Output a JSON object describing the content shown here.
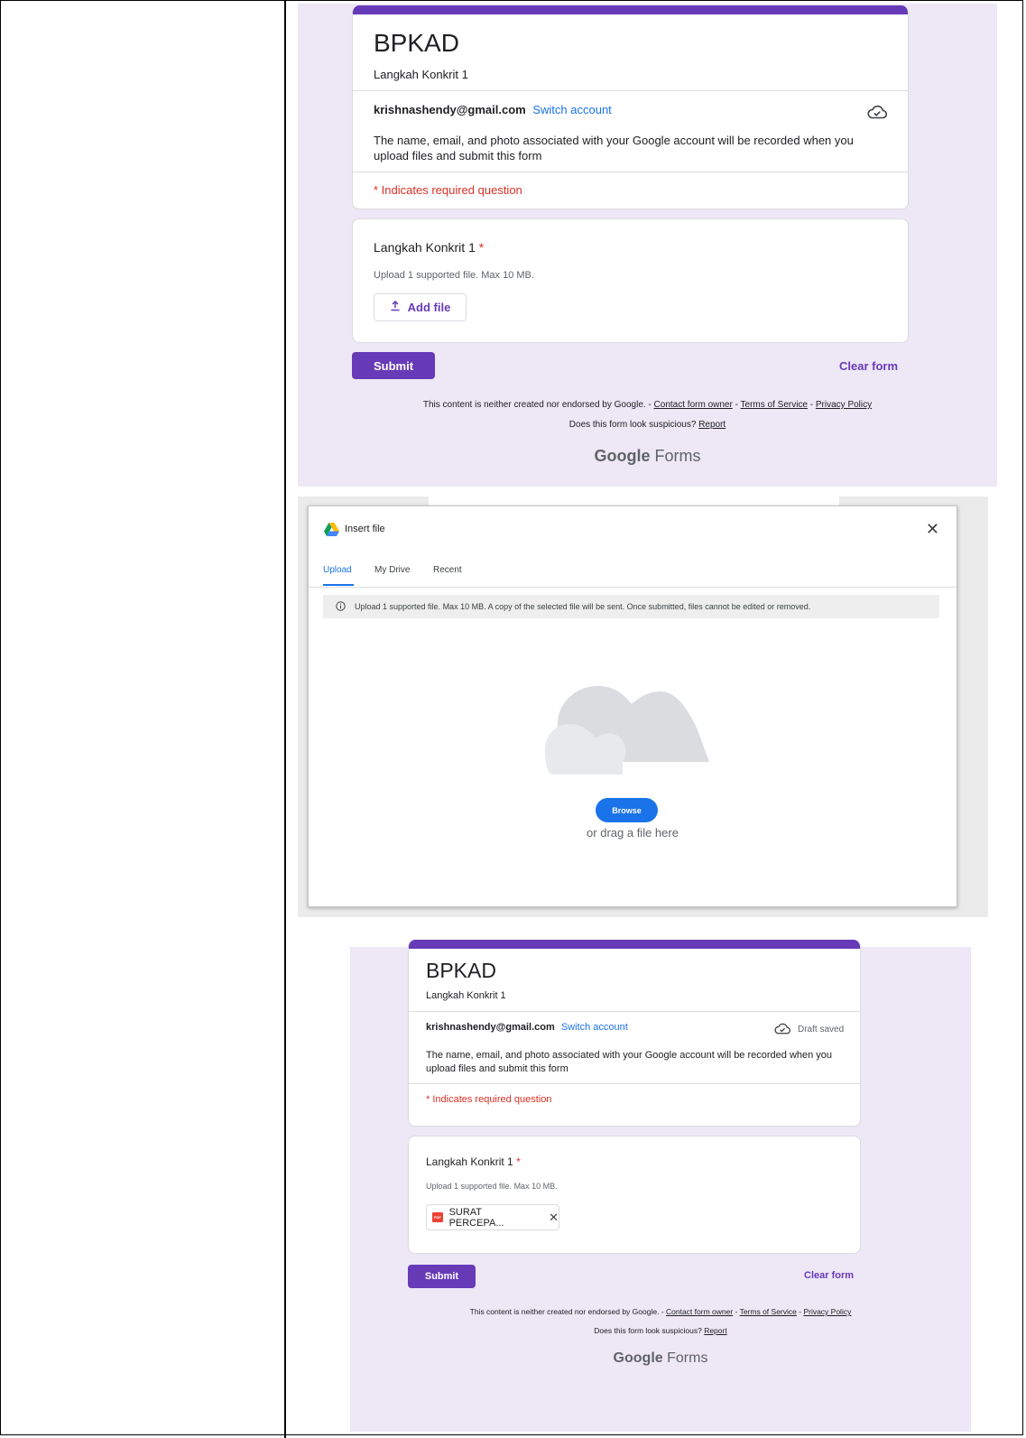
{
  "form": {
    "title": "BPKAD",
    "subtitle": "Langkah Konkrit 1",
    "email": "krishnashendy@gmail.com",
    "switch_account": "Switch account",
    "notice_line1": "The name, email, and photo associated with your Google account will be recorded when you",
    "notice_line2": "upload files and submit this form",
    "required_note": "* Indicates required question",
    "question_title": "Langkah Konkrit 1",
    "required_star": "*",
    "question_help": "Upload 1 supported file. Max 10 MB.",
    "add_file_label": "Add file",
    "submit_label": "Submit",
    "clear_label": "Clear form",
    "draft_saved": "Draft saved",
    "attached_file": "SURAT PERCEPA...",
    "accent_color": "#673ab7",
    "background_color": "#ede7f6"
  },
  "footer": {
    "disclaimer": "This content is neither created nor endorsed by Google.",
    "sep": " - ",
    "contact": "Contact form owner",
    "terms": "Terms of Service",
    "privacy": "Privacy Policy",
    "suspicious": "Does this form look suspicious?",
    "report": "Report",
    "brand_bold": "Google",
    "brand_rest": "Forms"
  },
  "dialog": {
    "title": "Insert file",
    "tabs": [
      "Upload",
      "My Drive",
      "Recent"
    ],
    "info": "Upload 1 supported file. Max 10 MB. A copy of the selected file will be sent. Once submitted, files cannot be edited or removed.",
    "browse_label": "Browse",
    "drag_text": "or drag a file here",
    "primary_color": "#1a73e8"
  },
  "icons": [
    "cloud-saved-icon",
    "upload-icon",
    "google-drive-icon",
    "close-icon",
    "info-icon",
    "cloud-illustration",
    "pdf-icon"
  ]
}
